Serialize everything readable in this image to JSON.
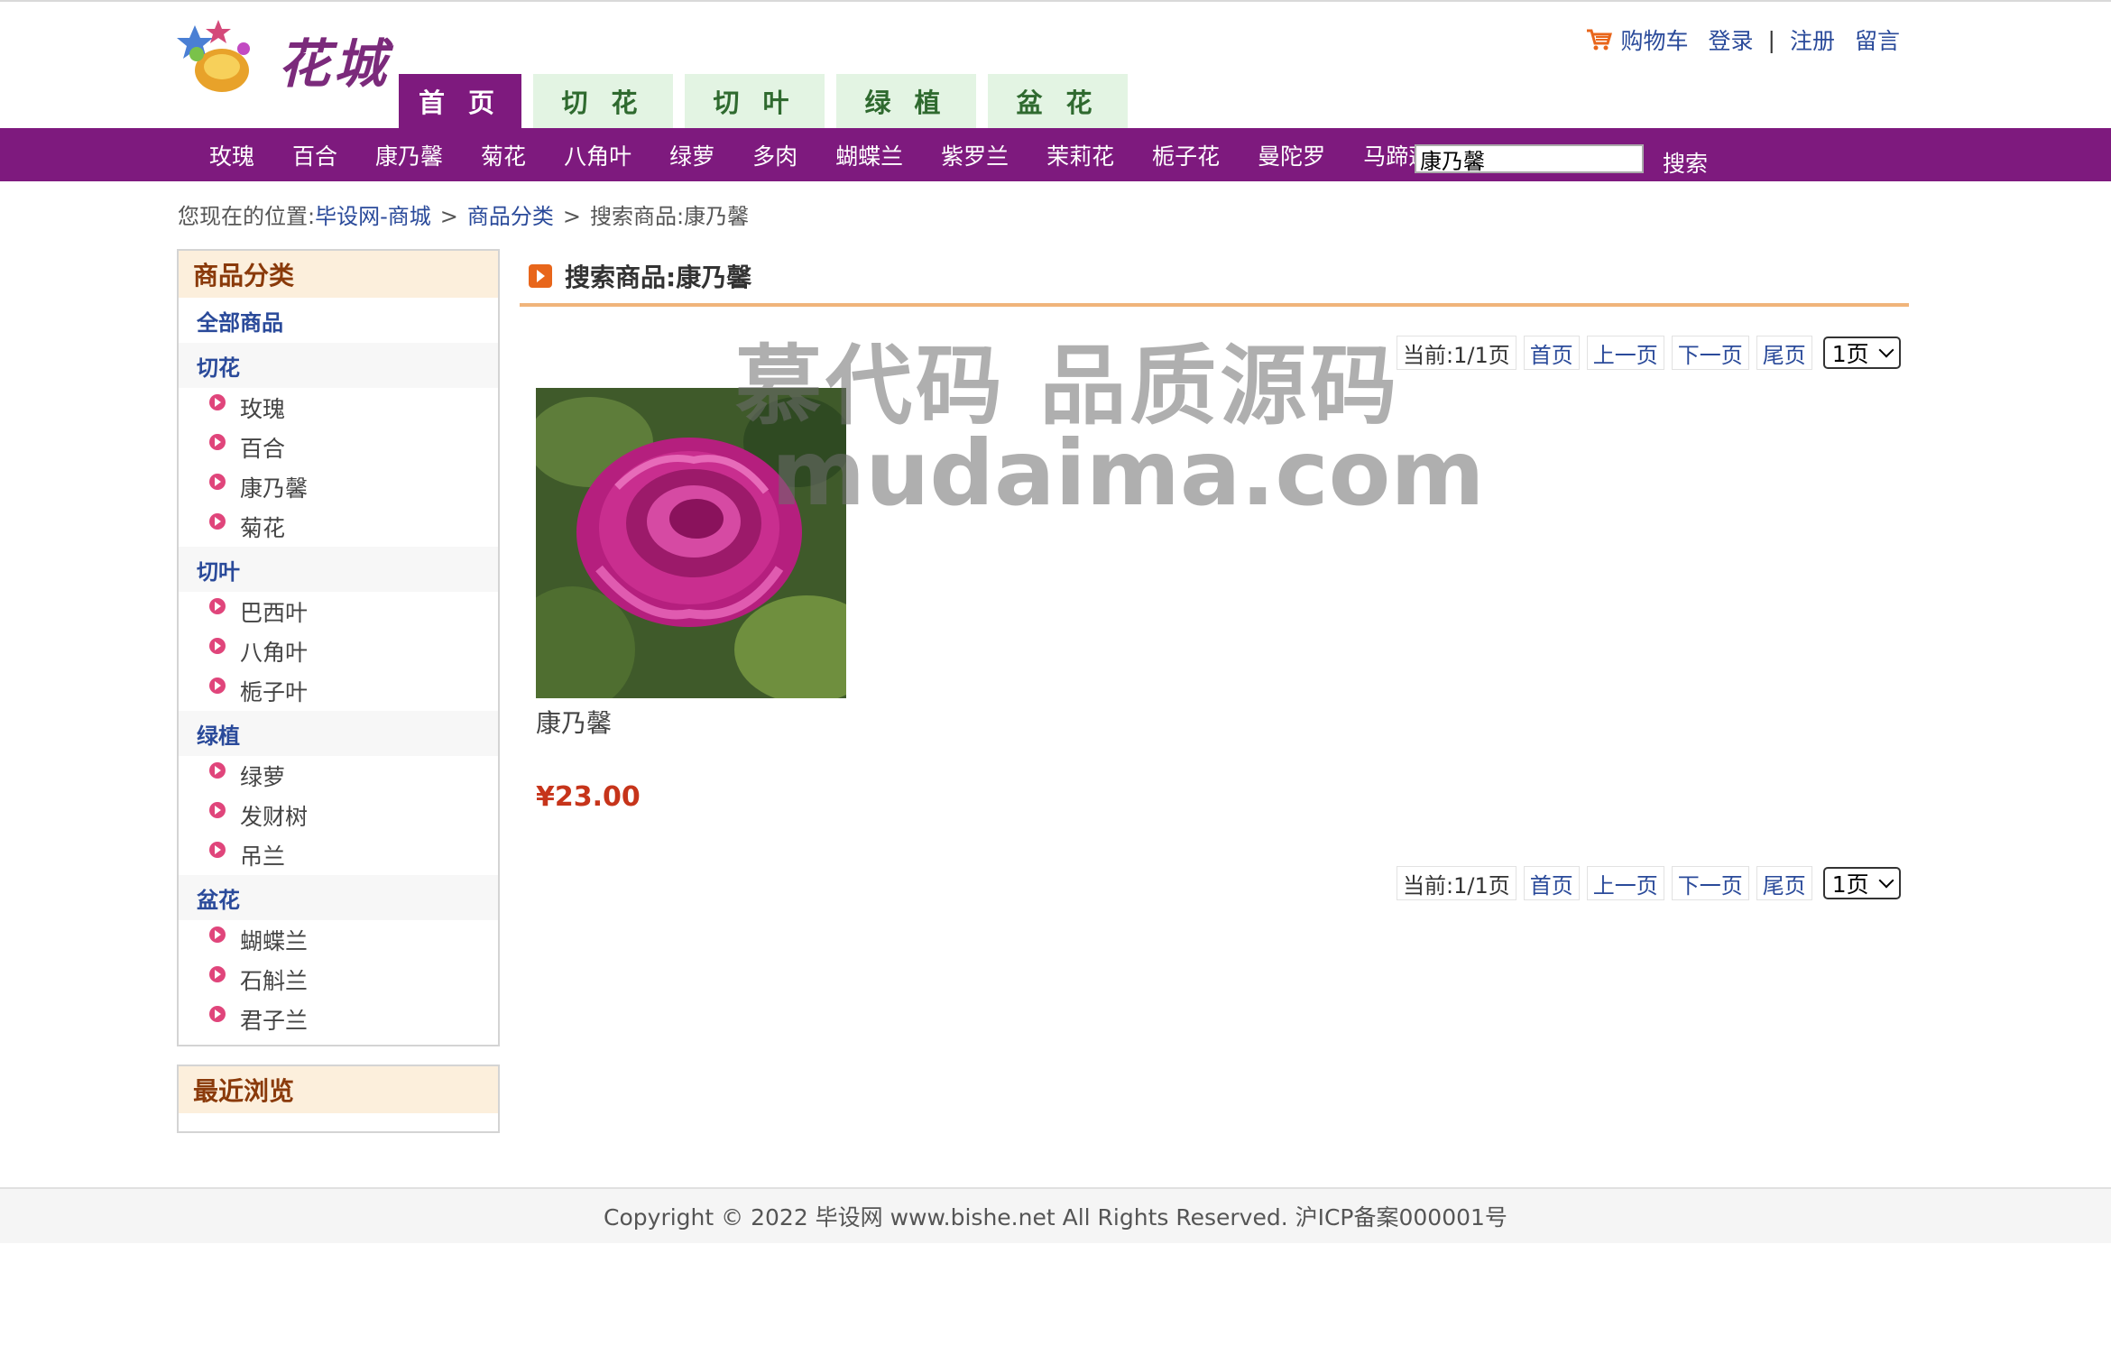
{
  "header": {
    "logo_text": "花城",
    "cart_label": "购物车",
    "login_label": "登录",
    "separator": "|",
    "register_label": "注册",
    "message_label": "留言",
    "tabs": [
      "首 页",
      "切 花",
      "切 叶",
      "绿 植",
      "盆 花"
    ]
  },
  "nav": {
    "items": [
      "玫瑰",
      "百合",
      "康乃馨",
      "菊花",
      "八角叶",
      "绿萝",
      "多肉",
      "蝴蝶兰",
      "紫罗兰",
      "茉莉花",
      "栀子花",
      "曼陀罗",
      "马蹄莲"
    ],
    "search_value": "康乃馨",
    "search_button": "搜索"
  },
  "breadcrumb": {
    "prefix": "您现在的位置:",
    "home": "毕设网-商城",
    "category": "商品分类",
    "current": "搜索商品:康乃馨",
    "arrow": ">"
  },
  "sidebar": {
    "category_title": "商品分类",
    "all_products": "全部商品",
    "groups": [
      {
        "title": "切花",
        "items": [
          "玫瑰",
          "百合",
          "康乃馨",
          "菊花"
        ]
      },
      {
        "title": "切叶",
        "items": [
          "巴西叶",
          "八角叶",
          "栀子叶"
        ]
      },
      {
        "title": "绿植",
        "items": [
          "绿萝",
          "发财树",
          "吊兰"
        ]
      },
      {
        "title": "盆花",
        "items": [
          "蝴蝶兰",
          "石斛兰",
          "君子兰"
        ]
      }
    ],
    "recent_title": "最近浏览"
  },
  "main": {
    "title": "搜索商品:康乃馨",
    "pager": {
      "current": "当前:1/1页",
      "first": "首页",
      "prev": "上一页",
      "next": "下一页",
      "last": "尾页",
      "select": "1页"
    },
    "product": {
      "name": "康乃馨",
      "price": "¥23.00"
    }
  },
  "watermark": {
    "line1": "慕代码 品质源码",
    "line2": "mudaima.com"
  },
  "footer": {
    "text": "Copyright © 2022 毕设网 www.bishe.net All Rights Reserved. 沪ICP备案000001号"
  },
  "colors": {
    "brand_purple": "#7e1a7e",
    "link_blue": "#2a4a9a",
    "price_red": "#c6341a",
    "tab_green_bg": "#e3f4e3",
    "sidebar_head_bg": "#fcefdc"
  }
}
